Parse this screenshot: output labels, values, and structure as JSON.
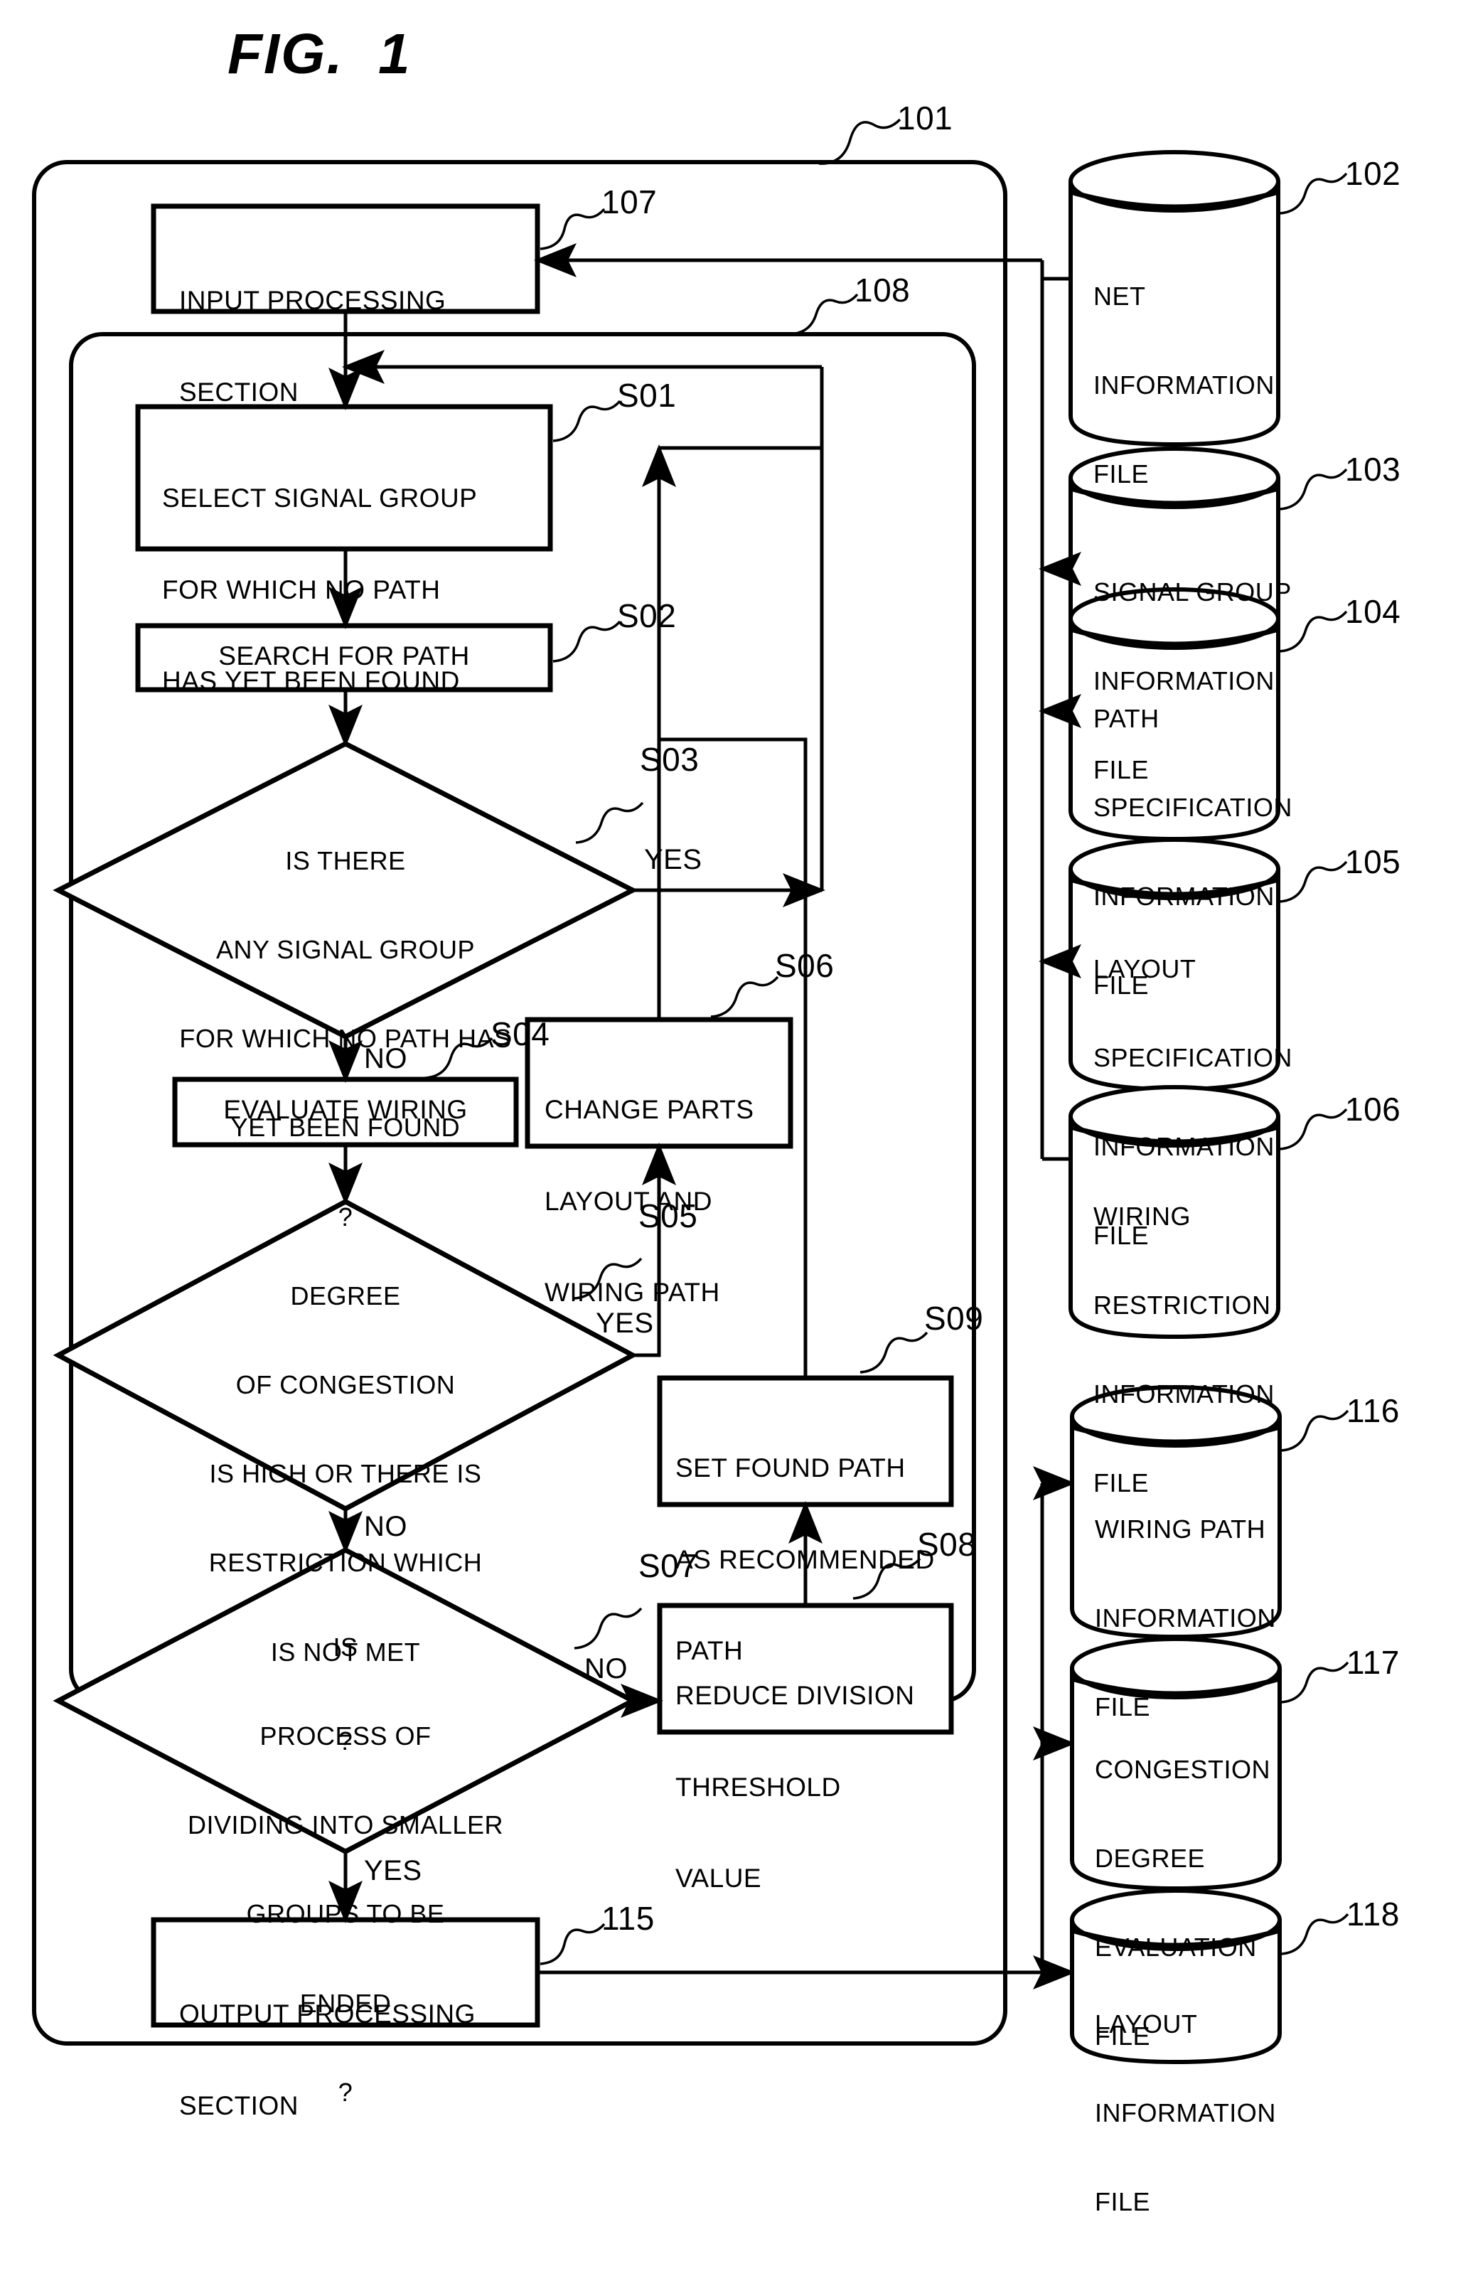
{
  "figure": {
    "title": "FIG.  1",
    "type": "patent-flowchart"
  },
  "containers": [
    {
      "id": "outer",
      "ref": "101"
    },
    {
      "id": "inner",
      "ref": "108"
    }
  ],
  "process_boxes": [
    {
      "ref": "107",
      "lines": [
        "INPUT PROCESSING",
        "SECTION"
      ],
      "align": "left"
    },
    {
      "ref": "S01",
      "lines": [
        "SELECT SIGNAL GROUP",
        "FOR WHICH NO PATH",
        "HAS YET BEEN FOUND"
      ],
      "align": "left"
    },
    {
      "ref": "S02",
      "lines": [
        "SEARCH FOR PATH"
      ],
      "align": "center"
    },
    {
      "ref": "S04",
      "lines": [
        "EVALUATE WIRING"
      ],
      "align": "center"
    },
    {
      "ref": "S06",
      "lines": [
        "CHANGE PARTS",
        "LAYOUT AND",
        "WIRING PATH"
      ],
      "align": "left"
    },
    {
      "ref": "S09",
      "lines": [
        "SET FOUND PATH",
        "AS RECOMMENDED",
        "PATH"
      ],
      "align": "left"
    },
    {
      "ref": "S08",
      "lines": [
        "REDUCE DIVISION",
        "THRESHOLD",
        "VALUE"
      ],
      "align": "left"
    },
    {
      "ref": "115",
      "lines": [
        "OUTPUT PROCESSING",
        "SECTION"
      ],
      "align": "left"
    }
  ],
  "decisions": [
    {
      "ref": "S03",
      "lines": [
        "IS THERE",
        "ANY SIGNAL GROUP",
        "FOR WHICH NO PATH HAS",
        "YET BEEN FOUND",
        "?"
      ],
      "yes_label": "YES",
      "no_label": "NO"
    },
    {
      "ref": "S05",
      "lines": [
        "DEGREE",
        "OF CONGESTION",
        "IS HIGH OR THERE IS",
        "RESTRICTION WHICH",
        "IS NOT MET",
        "?"
      ],
      "yes_label": "YES",
      "no_label": "NO"
    },
    {
      "ref": "S07",
      "lines": [
        "IS",
        "PROCESS OF",
        "DIVIDING INTO SMALLER",
        "GROUPS TO BE",
        "ENDED",
        "?"
      ],
      "yes_label": "YES",
      "no_label": "NO"
    }
  ],
  "databases": [
    {
      "ref": "102",
      "lines": [
        "NET",
        "INFORMATION",
        "FILE"
      ]
    },
    {
      "ref": "103",
      "lines": [
        "SIGNAL GROUP",
        "INFORMATION",
        "FILE"
      ]
    },
    {
      "ref": "104",
      "lines": [
        "PATH",
        "SPECIFICATION",
        "INFORMATION",
        "FILE"
      ]
    },
    {
      "ref": "105",
      "lines": [
        "LAYOUT",
        "SPECIFICATION",
        "INFORMATION",
        "FILE"
      ]
    },
    {
      "ref": "106",
      "lines": [
        "WIRING",
        "RESTRICTION",
        "INFORMATION",
        "FILE"
      ]
    },
    {
      "ref": "116",
      "lines": [
        "WIRING PATH",
        "INFORMATION",
        "FILE"
      ]
    },
    {
      "ref": "117",
      "lines": [
        "CONGESTION",
        "DEGREE",
        "EVALUATION",
        "FILE"
      ]
    },
    {
      "ref": "118",
      "lines": [
        "LAYOUT",
        "INFORMATION",
        "FILE"
      ]
    }
  ],
  "edge_labels": {
    "s03_yes": "YES",
    "s03_no": "NO",
    "s05_yes": "YES",
    "s05_no": "NO",
    "s07_yes": "YES",
    "s07_no": "NO"
  },
  "colors": {
    "ink": "#000000",
    "paper": "#ffffff"
  }
}
